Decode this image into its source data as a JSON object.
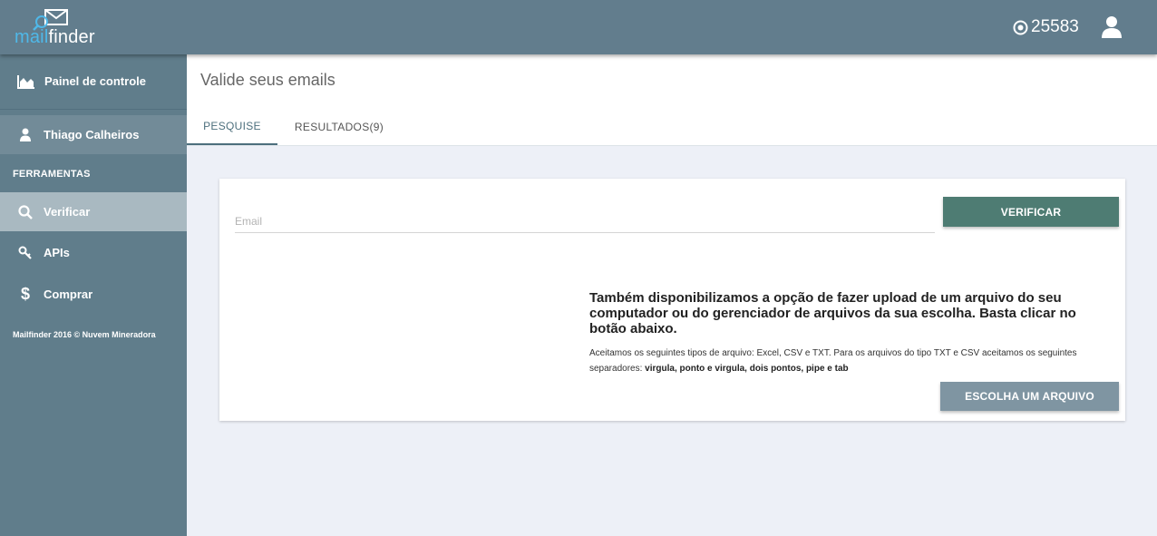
{
  "header": {
    "logo_prefix": "mail",
    "logo_suffix": "finder",
    "credits": "25583",
    "colors": {
      "bar": "#627d8d",
      "logo_accent": "#4fb8e8"
    }
  },
  "sidebar": {
    "dashboard_label": "Painel de controle",
    "user_name": "Thiago Calheiros",
    "section_label": "FERRAMENTAS",
    "items": [
      {
        "label": "Verificar",
        "icon": "search-icon",
        "active": true
      },
      {
        "label": "APIs",
        "icon": "key-icon",
        "active": false
      },
      {
        "label": "Comprar",
        "icon": "dollar-icon",
        "active": false
      }
    ],
    "footer": "Mailfinder 2016 © Nuvem Mineradora"
  },
  "main": {
    "title": "Valide seus emails",
    "tabs": [
      {
        "label": "PESQUISE",
        "active": true
      },
      {
        "label": "RESULTADOS(9)",
        "active": false
      }
    ]
  },
  "form": {
    "email_placeholder": "Email",
    "email_value": "",
    "verify_label": "VERIFICAR",
    "upload_text": "Também disponibilizamos a opção de fazer upload de um arquivo do seu computador ou do gerenciador de arquivos da sua escolha. Basta clicar no botão abaixo.",
    "upload_note": "Aceitamos os seguintes tipos de arquivo: Excel, CSV e TXT. Para os arquivos do tipo TXT e CSV aceitamos os seguintes separadores: ",
    "upload_note_bold": "virgula, ponto e virgula, dois pontos, pipe e tab",
    "file_button_label": "ESCOLHA UM ARQUIVO",
    "colors": {
      "verify_button": "#4e7c73",
      "file_button": "#7f95a2"
    }
  }
}
